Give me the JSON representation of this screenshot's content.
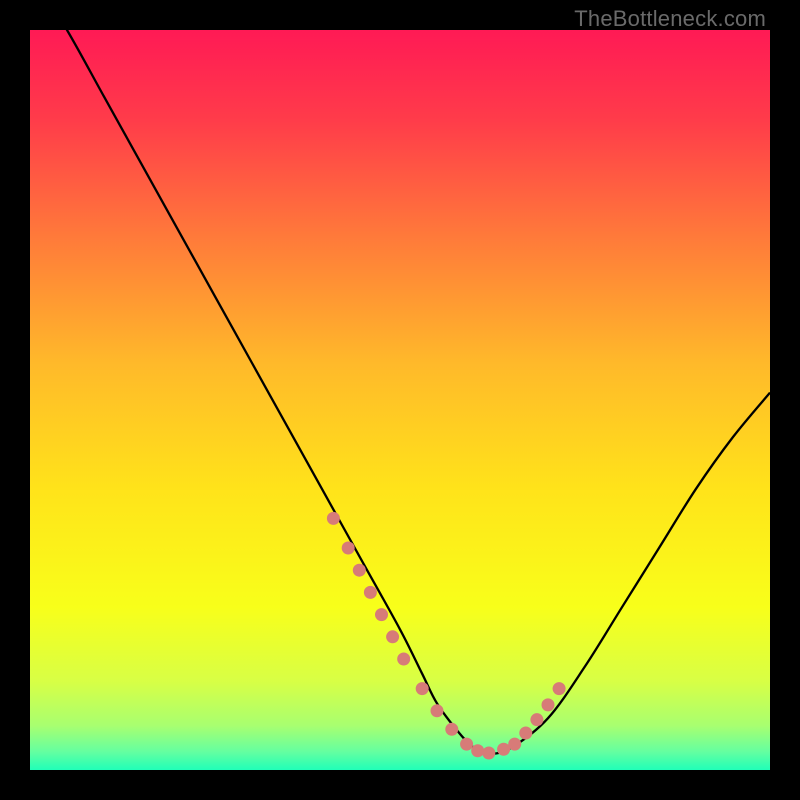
{
  "watermark": {
    "text": "TheBottleneck.com"
  },
  "colors": {
    "bg": "#000000",
    "curve": "#000000",
    "marker": "#d77b78",
    "gradient_stops": [
      {
        "offset": 0.0,
        "color": "#ff1a55"
      },
      {
        "offset": 0.12,
        "color": "#ff3b4a"
      },
      {
        "offset": 0.28,
        "color": "#ff7a3a"
      },
      {
        "offset": 0.45,
        "color": "#ffb92a"
      },
      {
        "offset": 0.62,
        "color": "#ffe31a"
      },
      {
        "offset": 0.78,
        "color": "#f8ff1a"
      },
      {
        "offset": 0.88,
        "color": "#d8ff45"
      },
      {
        "offset": 0.94,
        "color": "#a8ff70"
      },
      {
        "offset": 0.975,
        "color": "#65ffa0"
      },
      {
        "offset": 1.0,
        "color": "#20ffb8"
      }
    ]
  },
  "chart_data": {
    "type": "line",
    "title": "",
    "xlabel": "",
    "ylabel": "",
    "xlim": [
      0,
      100
    ],
    "ylim": [
      0,
      100
    ],
    "grid": false,
    "series": [
      {
        "name": "bottleneck-curve",
        "x": [
          0,
          5,
          10,
          15,
          20,
          25,
          30,
          35,
          40,
          45,
          50,
          53,
          55,
          58,
          60,
          62,
          65,
          70,
          75,
          80,
          85,
          90,
          95,
          100
        ],
        "y": [
          108,
          100,
          91,
          82,
          73,
          64,
          55,
          46,
          37,
          28,
          19,
          13,
          9,
          5,
          3,
          2.2,
          3,
          7,
          14,
          22,
          30,
          38,
          45,
          51
        ]
      }
    ],
    "markers": {
      "name": "highlight-dots",
      "x": [
        41,
        43,
        44.5,
        46,
        47.5,
        49,
        50.5,
        53,
        55,
        57,
        59,
        60.5,
        62,
        64,
        65.5,
        67,
        68.5,
        70,
        71.5
      ],
      "y": [
        34,
        30,
        27,
        24,
        21,
        18,
        15,
        11,
        8,
        5.5,
        3.5,
        2.6,
        2.3,
        2.8,
        3.5,
        5,
        6.8,
        8.8,
        11
      ]
    }
  }
}
